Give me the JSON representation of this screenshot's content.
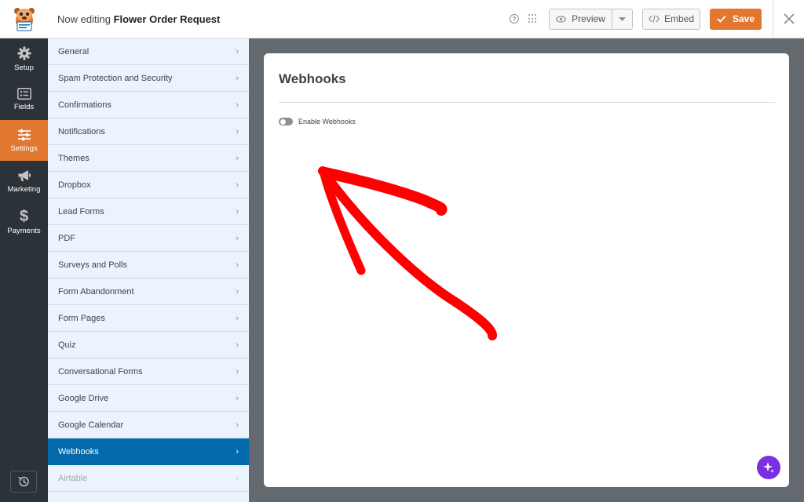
{
  "header": {
    "editing_prefix": "Now editing",
    "form_name": "Flower Order Request",
    "preview_label": "Preview",
    "embed_label": "Embed",
    "save_label": "Save"
  },
  "leftnav": {
    "items": [
      {
        "label": "Setup",
        "icon": "gear-icon"
      },
      {
        "label": "Fields",
        "icon": "fields-icon"
      },
      {
        "label": "Settings",
        "icon": "sliders-icon",
        "active": true
      },
      {
        "label": "Marketing",
        "icon": "megaphone-icon"
      },
      {
        "label": "Payments",
        "icon": "dollar-icon"
      }
    ]
  },
  "settings_panel": {
    "items": [
      {
        "label": "General"
      },
      {
        "label": "Spam Protection and Security"
      },
      {
        "label": "Confirmations"
      },
      {
        "label": "Notifications"
      },
      {
        "label": "Themes"
      },
      {
        "label": "Dropbox"
      },
      {
        "label": "Lead Forms"
      },
      {
        "label": "PDF"
      },
      {
        "label": "Surveys and Polls"
      },
      {
        "label": "Form Abandonment"
      },
      {
        "label": "Form Pages"
      },
      {
        "label": "Quiz"
      },
      {
        "label": "Conversational Forms"
      },
      {
        "label": "Google Drive"
      },
      {
        "label": "Google Calendar"
      },
      {
        "label": "Webhooks",
        "active": true
      },
      {
        "label": "Airtable",
        "disabled": true
      }
    ]
  },
  "main": {
    "title": "Webhooks",
    "toggle_label": "Enable Webhooks",
    "toggle_enabled": false
  },
  "colors": {
    "accent_orange": "#e27730",
    "active_blue": "#036aab",
    "panel_bg": "#ebf3fc",
    "nav_bg": "#2c3338",
    "annotation_red": "#ff0000",
    "ai_purple": "#7a30e2"
  }
}
